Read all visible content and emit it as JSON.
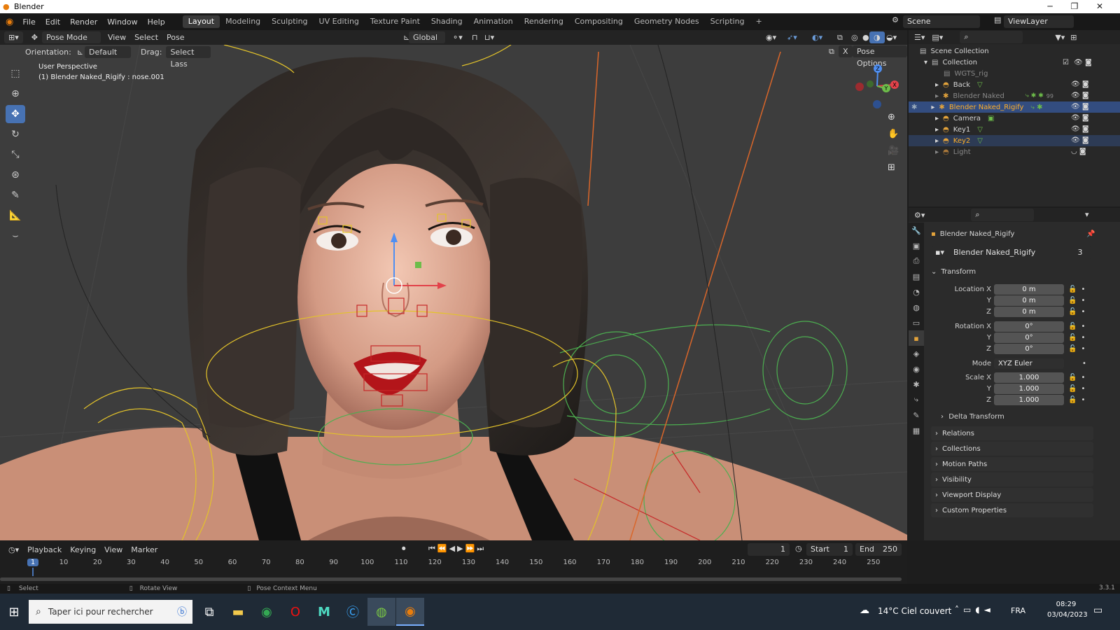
{
  "window": {
    "title": "Blender",
    "min_icon": "minimize-icon",
    "max_icon": "restore-icon",
    "close_icon": "close-icon"
  },
  "menus": [
    "File",
    "Edit",
    "Render",
    "Window",
    "Help"
  ],
  "workspaces": [
    "Layout",
    "Modeling",
    "Sculpting",
    "UV Editing",
    "Texture Paint",
    "Shading",
    "Animation",
    "Rendering",
    "Compositing",
    "Geometry Nodes",
    "Scripting"
  ],
  "add_workspace": "+",
  "scene": {
    "name": "Scene",
    "view_layer": "ViewLayer"
  },
  "viewport_header": {
    "mode": "Pose Mode",
    "menus": [
      "View",
      "Select",
      "Pose"
    ],
    "transform_orientation": "Global",
    "orientation_label": "Orientation:",
    "orientation_value": "Default",
    "drag_label": "Drag:",
    "drag_value": "Select Lass",
    "pose_options": "Pose Options",
    "x_label": "X"
  },
  "viewport": {
    "perspective": "User Perspective",
    "active": "(1) Blender Naked_Rigify : nose.001",
    "gizmo_axes": [
      "X",
      "Y",
      "Z"
    ]
  },
  "outliner": {
    "root": "Scene Collection",
    "collection": "Collection",
    "items": [
      {
        "label": "WGTS_rig",
        "dim": true
      },
      {
        "label": "Back",
        "dim": false
      },
      {
        "label": "Blender Naked",
        "dim": true,
        "badge": "99"
      },
      {
        "label": "Blender Naked_Rigify",
        "dim": false,
        "selected": true
      },
      {
        "label": "Camera",
        "dim": false
      },
      {
        "label": "Key1",
        "dim": false
      },
      {
        "label": "Key2",
        "dim": false,
        "highlight": true
      },
      {
        "label": "Light",
        "dim": true
      }
    ]
  },
  "properties": {
    "object_name": "Blender Naked_Rigify",
    "data_name": "Blender Naked_Rigify",
    "users": "3",
    "transform": "Transform",
    "location_label": "Location X",
    "rotation_label": "Rotation X",
    "scale_label": "Scale X",
    "y": "Y",
    "z": "Z",
    "location": [
      "0 m",
      "0 m",
      "0 m"
    ],
    "rotation": [
      "0°",
      "0°",
      "0°"
    ],
    "mode_label": "Mode",
    "mode_value": "XYZ Euler",
    "scale": [
      "1.000",
      "1.000",
      "1.000"
    ],
    "panels": [
      "Delta Transform",
      "Relations",
      "Collections",
      "Motion Paths",
      "Visibility",
      "Viewport Display",
      "Custom Properties"
    ]
  },
  "timeline": {
    "menus": [
      "Playback",
      "Keying",
      "View",
      "Marker"
    ],
    "current_frame": "1",
    "start_label": "Start",
    "start": "1",
    "end_label": "End",
    "end": "250",
    "ticks": [
      "1",
      "10",
      "20",
      "30",
      "40",
      "50",
      "60",
      "70",
      "80",
      "90",
      "100",
      "110",
      "120",
      "130",
      "140",
      "150",
      "160",
      "170",
      "180",
      "190",
      "200",
      "210",
      "220",
      "230",
      "240",
      "250"
    ]
  },
  "statusbar": {
    "left": "Select",
    "middle": "Rotate View",
    "right": "Pose Context Menu",
    "version": "3.3.1"
  },
  "taskbar": {
    "search_placeholder": "Taper ici pour rechercher",
    "weather": "14°C  Ciel couvert",
    "lang": "FRA",
    "time": "08:29",
    "date": "03/04/2023"
  }
}
